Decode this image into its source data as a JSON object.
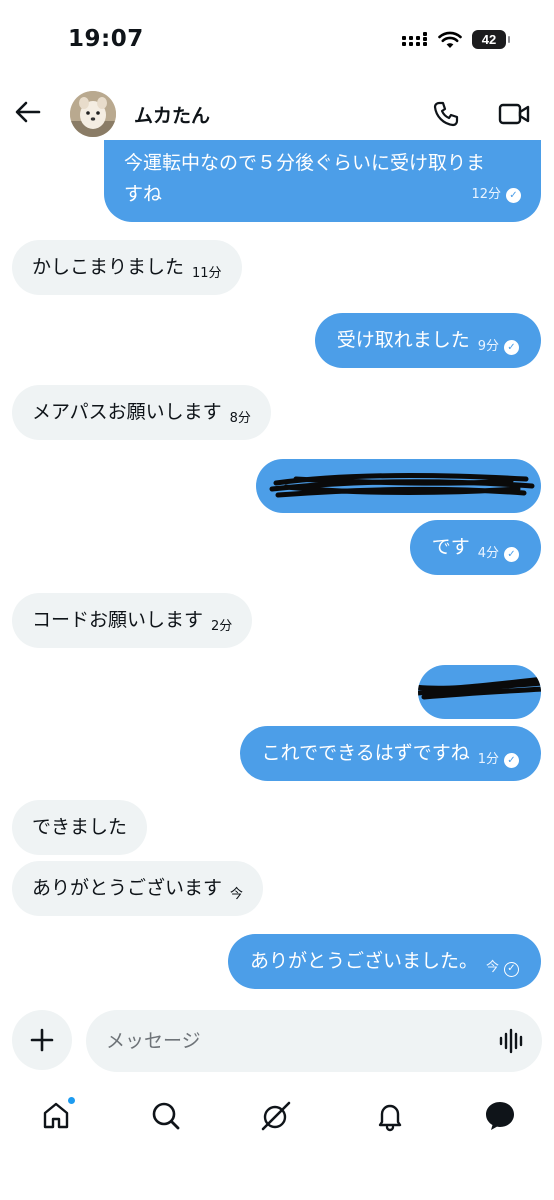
{
  "status_bar": {
    "time": "19:07",
    "battery": "42"
  },
  "header": {
    "contact_name": "ムカたん"
  },
  "messages": [
    {
      "direction": "out",
      "lines": [
        "今運転中なので５分後ぐらいに受け取りま",
        "すね"
      ],
      "time": "12分",
      "status": "read"
    },
    {
      "direction": "in",
      "text": "かしこまりました",
      "time": "11分"
    },
    {
      "direction": "out",
      "text": "受け取れました",
      "time": "9分",
      "status": "read"
    },
    {
      "direction": "in",
      "text": "メアパスお願いします",
      "time": "8分"
    },
    {
      "direction": "out",
      "text": "",
      "redacted": true
    },
    {
      "direction": "out",
      "text": "です",
      "time": "4分",
      "status": "read"
    },
    {
      "direction": "in",
      "text": "コードお願いします",
      "time": "2分"
    },
    {
      "direction": "out",
      "text": "",
      "redacted": true
    },
    {
      "direction": "out",
      "text": "これでできるはずですね",
      "time": "1分",
      "status": "read"
    },
    {
      "direction": "in",
      "text": "できました",
      "time": ""
    },
    {
      "direction": "in",
      "text": "ありがとうございます",
      "time": "今"
    },
    {
      "direction": "out",
      "text": "ありがとうございました。",
      "time": "今",
      "status": "sent"
    }
  ],
  "composer": {
    "placeholder": "メッセージ"
  },
  "tab_bar": {
    "items": [
      "home-icon",
      "search-icon",
      "grok-icon",
      "notifications-icon",
      "messages-icon"
    ]
  },
  "colors": {
    "outgoing_bubble": "#4c9ee8",
    "incoming_bubble": "#eff3f4",
    "accent": "#1d9bf0"
  }
}
